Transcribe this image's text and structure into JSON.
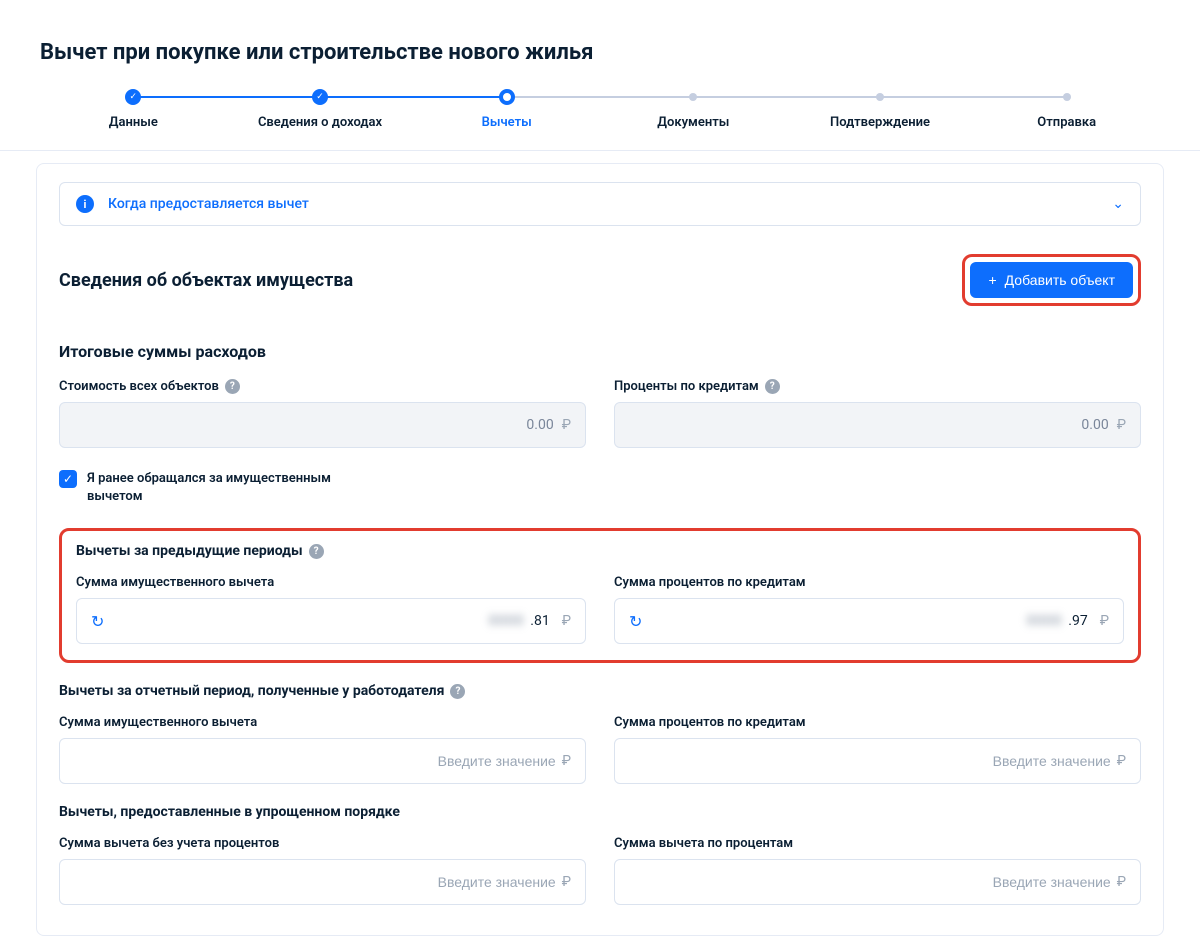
{
  "page_title": "Вычет при покупке или строительстве нового жилья",
  "stepper": {
    "steps": [
      {
        "label": "Данные",
        "state": "completed"
      },
      {
        "label": "Сведения о доходах",
        "state": "completed"
      },
      {
        "label": "Вычеты",
        "state": "current"
      },
      {
        "label": "Документы",
        "state": "future"
      },
      {
        "label": "Подтверждение",
        "state": "future"
      },
      {
        "label": "Отправка",
        "state": "future"
      }
    ]
  },
  "info_banner": "Когда предоставляется вычет",
  "section_objects": {
    "title": "Сведения об объектах имущества",
    "add_button": "Добавить объект"
  },
  "section_totals": {
    "title": "Итоговые суммы расходов",
    "cost_label": "Стоимость всех объектов",
    "cost_value": "0.00",
    "loan_label": "Проценты по кредитам",
    "loan_value": "0.00"
  },
  "checkbox_prev": {
    "label": "Я ранее обращался за имущественным вычетом",
    "checked": true
  },
  "group_prev": {
    "title": "Вычеты за предыдущие периоды",
    "sum_deduction_label": "Сумма имущественного вычета",
    "sum_deduction_tail": ".81",
    "sum_loan_label": "Сумма процентов по кредитам",
    "sum_loan_tail": ".97"
  },
  "group_employer": {
    "title": "Вычеты за отчетный период, полученные у работодателя",
    "sum_deduction_label": "Сумма имущественного вычета",
    "sum_loan_label": "Сумма процентов по кредитам",
    "placeholder": "Введите значение"
  },
  "group_simple": {
    "title": "Вычеты, предоставленные в упрощенном порядке",
    "sum_no_interest_label": "Сумма вычета без учета процентов",
    "sum_interest_label": "Сумма вычета по процентам",
    "placeholder": "Введите значение"
  },
  "currency_symbol": "₽"
}
